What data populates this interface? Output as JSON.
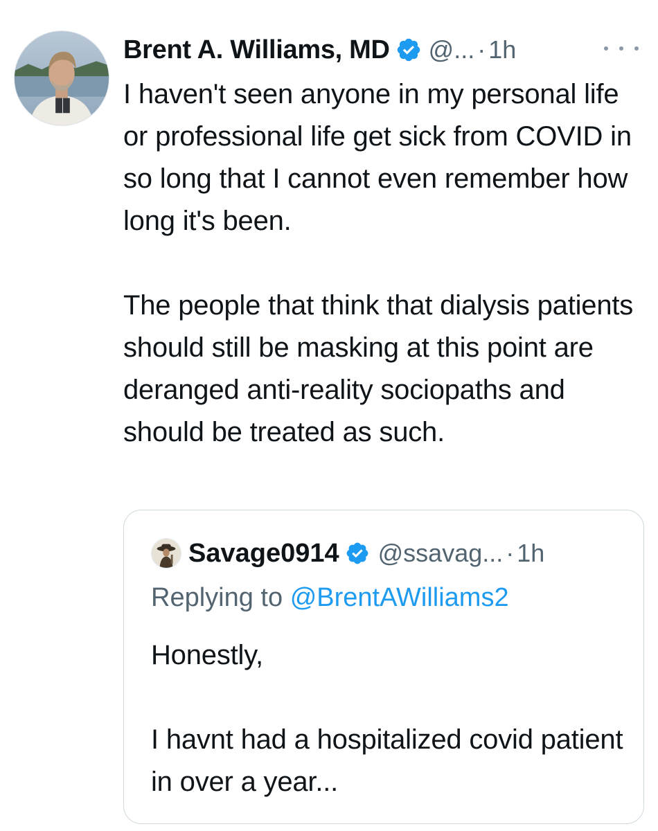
{
  "author": {
    "display_name": "Brent A. Williams, MD",
    "handle": "@...",
    "separator": "·",
    "time": "1h",
    "avatar_icon": "profile-photo",
    "verified_icon": "verified-badge-icon"
  },
  "tweet": {
    "paragraphs": [
      "I haven't seen anyone in my personal life or professional life get sick from COVID in so long that I cannot even remember how long it's been.",
      "The people that think that dialysis patients should still be masking at this point are deranged anti-reality sociopaths and should be treated as such."
    ],
    "more_icon": "more-options-icon"
  },
  "quoted": {
    "display_name": "Savage0914",
    "handle": "@ssavag...",
    "separator": "·",
    "time": "1h",
    "replying_prefix": "Replying to",
    "replying_mention": "@BrentAWilliams2",
    "paragraphs": [
      "Honestly,",
      "I havnt had a hospitalized covid patient in over a year..."
    ]
  },
  "colors": {
    "text": "#0f1419",
    "secondary": "#536471",
    "link": "#1d9bf0",
    "verified": "#1d9bf0",
    "border": "#cfd9de"
  }
}
